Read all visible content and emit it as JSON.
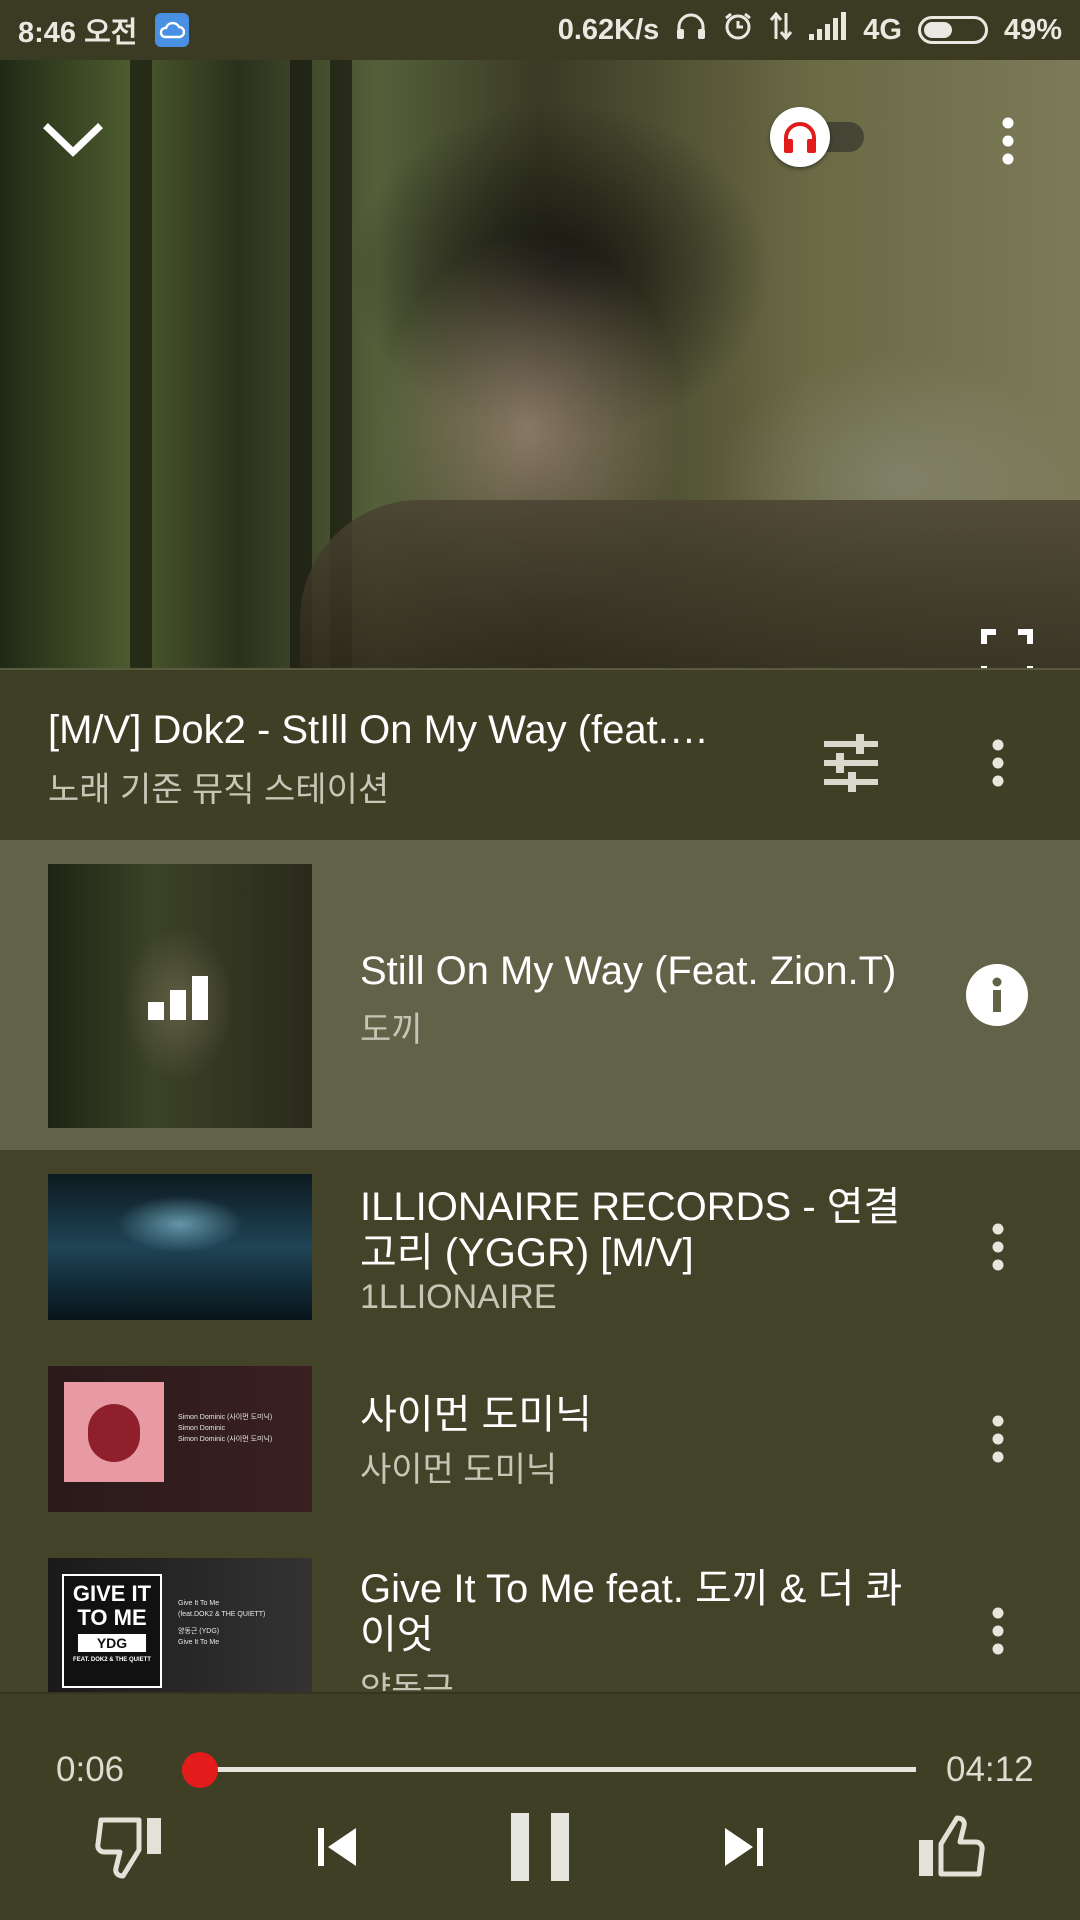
{
  "status_bar": {
    "time": "8:46 오전",
    "network_speed": "0.62K/s",
    "network_type": "4G",
    "battery": "49%",
    "battery_level": 0.49,
    "icons": [
      "cloud-icon",
      "headset-icon",
      "alarm-icon",
      "data-transfer-icon",
      "signal-icon",
      "battery-icon"
    ]
  },
  "video": {
    "collapse_icon": "chevron-down-icon",
    "audio_only_icon": "headphones-icon",
    "audio_only_enabled": true,
    "menu_icon": "more-vert-icon",
    "fullscreen_icon": "fullscreen-icon"
  },
  "now_playing": {
    "title": "[M/V] Dok2 - StIll On My Way (feat.…",
    "subtitle": "노래 기준 뮤직 스테이션"
  },
  "queue": [
    {
      "title": "Still On My Way (Feat. Zion.T)",
      "artist": "도끼",
      "playing": true
    },
    {
      "title": "ILLIONAIRE RECORDS - 연결고리 (YGGR) [M/V]",
      "artist": "1LLIONAIRE",
      "playing": false
    },
    {
      "title": "사이먼 도미닉",
      "artist": "사이먼 도미닉",
      "playing": false,
      "thumb_text": [
        "Simon Dominic (사이먼 도미닉)",
        "Simon Dominic",
        "Simon Dominic (사이먼 도미닉)"
      ]
    },
    {
      "title": "Give It To Me feat. 도끼 & 더 콰이엇",
      "artist": "양동근",
      "playing": false,
      "thumb_text": [
        "GIVE IT",
        "TO ME",
        "YDG",
        "FEAT. DOK2 & THE QUIETT",
        "Give It To Me",
        "(feat.DOK2 & THE QUIETT)",
        "양동근 (YDG)",
        "Give It To Me"
      ]
    }
  ],
  "player": {
    "elapsed": "0:06",
    "duration": "04:12",
    "progress": 0.024
  },
  "colors": {
    "background": "#434329",
    "active_row": "#626248",
    "accent": "#e31b1b"
  }
}
